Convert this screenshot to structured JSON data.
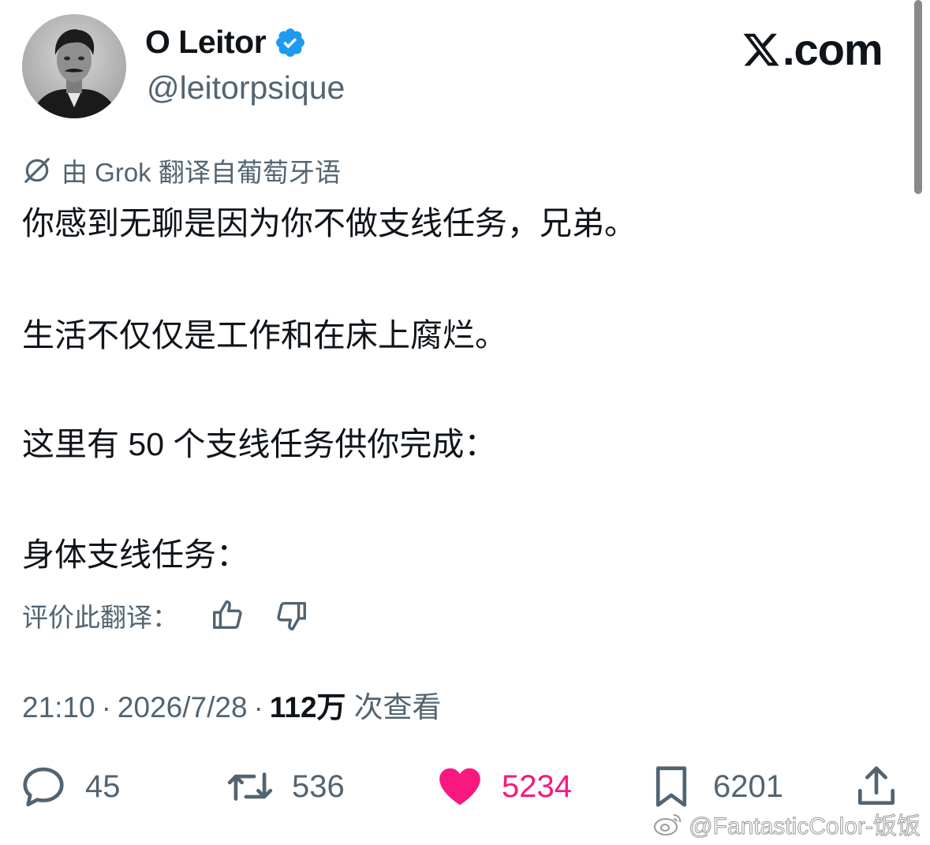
{
  "author": {
    "display_name": "O Leitor",
    "handle": "@leitorpsique",
    "verified": true
  },
  "site_label": ".com",
  "translation_note": "由 Grok 翻译自葡萄牙语",
  "tweet_paragraphs": [
    "你感到无聊是因为你不做支线任务，兄弟。",
    "生活不仅仅是工作和在床上腐烂。",
    "这里有 50 个支线任务供你完成：",
    "身体支线任务："
  ],
  "rate_translation_label": "评价此翻译：",
  "meta": {
    "time": "21:10",
    "date": "2026/7/28",
    "separator": "·",
    "views_count": "112万",
    "views_label": "次查看"
  },
  "actions": {
    "reply_count": "45",
    "repost_count": "536",
    "like_count": "5234",
    "bookmark_count": "6201"
  },
  "colors": {
    "like": "#f91880",
    "verified": "#1d9bf0",
    "secondary_text": "#536471",
    "primary_text": "#0f1419"
  },
  "icons": [
    "grok-icon",
    "verified-badge-icon",
    "x-logo-icon",
    "thumbs-up-icon",
    "thumbs-down-icon",
    "reply-icon",
    "repost-icon",
    "heart-icon",
    "bookmark-icon",
    "share-icon",
    "weibo-icon"
  ],
  "watermark": "@FantasticColor-饭饭"
}
